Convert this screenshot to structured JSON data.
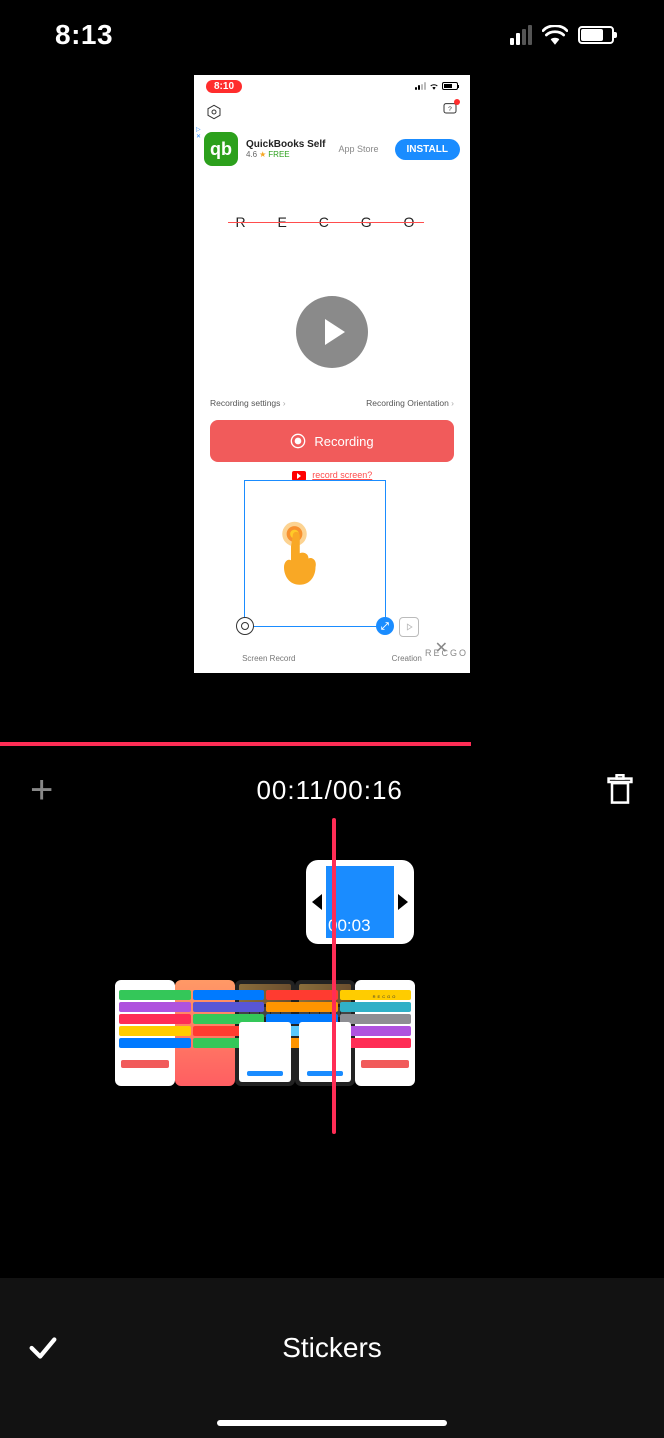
{
  "status_bar": {
    "time": "8:13"
  },
  "preview": {
    "inner_time": "8:10",
    "ad": {
      "logo_letter": "qb",
      "title": "QuickBooks Self",
      "rating": "4.6",
      "free": "FREE",
      "store": "App Store",
      "cta": "INSTALL"
    },
    "logo_text": "R E C G O",
    "settings_left": "Recording settings",
    "settings_right": "Recording Orientation",
    "recording_label": "Recording",
    "how_to_link": "record screen?",
    "tab_left": "Screen Record",
    "tab_right": "Creation",
    "watermark": "RECGO"
  },
  "timeline": {
    "timecode": "00:11/00:16",
    "clip_duration": "00:03"
  },
  "bottom": {
    "panel_title": "Stickers"
  },
  "colors": {
    "accent": "#ff2d55",
    "blue": "#1a8cff",
    "rec_red": "#f15b5b"
  }
}
